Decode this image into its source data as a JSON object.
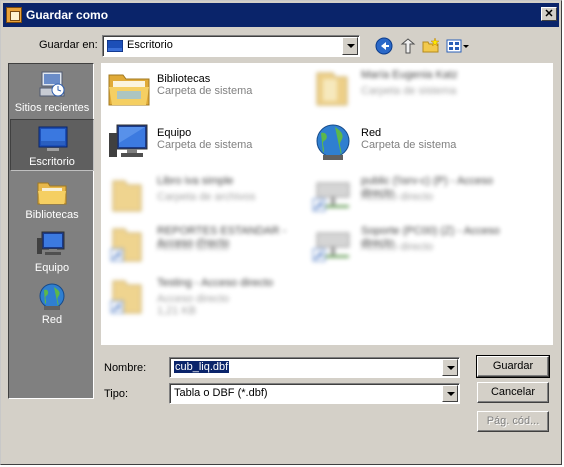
{
  "window": {
    "title": "Guardar como",
    "close_glyph": "✕"
  },
  "toolbar": {
    "save_in_label": "Guardar en:",
    "location": "Escritorio",
    "icons": [
      "back-icon",
      "up-folder-icon",
      "new-folder-icon",
      "views-menu-icon"
    ]
  },
  "places": [
    {
      "label": "Sitios recientes",
      "icon": "recent-places-icon"
    },
    {
      "label": "Escritorio",
      "icon": "desktop-icon",
      "selected": true
    },
    {
      "label": "Bibliotecas",
      "icon": "libraries-icon"
    },
    {
      "label": "Equipo",
      "icon": "computer-icon"
    },
    {
      "label": "Red",
      "icon": "network-icon"
    }
  ],
  "files": [
    {
      "name": "Bibliotecas",
      "type": "Carpeta de sistema",
      "icon": "libraries-icon"
    },
    {
      "name": "María Eugenia Katz",
      "type": "Carpeta de sistema",
      "icon": "user-folder-icon"
    },
    {
      "name": "Equipo",
      "type": "Carpeta de sistema",
      "icon": "computer-icon"
    },
    {
      "name": "Red",
      "type": "Carpeta de sistema",
      "icon": "network-icon"
    },
    {
      "name": "Libro iva simple",
      "type": "Carpeta de archivos",
      "icon": "folder-icon"
    },
    {
      "name": "public (\\\\srv-c) (P) - Acceso directo",
      "type": "Acceso directo",
      "icon": "network-drive-shortcut-icon"
    },
    {
      "name": "REPORTES ESTANDAR - Acceso directo",
      "type": "Acceso directo",
      "icon": "folder-shortcut-icon"
    },
    {
      "name": "Soporte (PC00) (Z) - Acceso directo",
      "type": "Acceso directo",
      "icon": "network-drive-shortcut-icon"
    },
    {
      "name": "Testing - Acceso directo",
      "type": "Acceso directo",
      "size": "1,21 KB",
      "icon": "folder-shortcut-icon"
    }
  ],
  "form": {
    "filename_label": "Nombre:",
    "filename_value": "cub_liq.dbf",
    "type_label": "Tipo:",
    "type_value": "Tabla o DBF (*.dbf)"
  },
  "buttons": {
    "save": "Guardar",
    "cancel": "Cancelar",
    "codepage": "Pág. cód..."
  },
  "colors": {
    "titlebar": "#0a246a",
    "dialog": "#d4d0c8",
    "places_bg": "#808080",
    "selection": "#0a246a"
  }
}
